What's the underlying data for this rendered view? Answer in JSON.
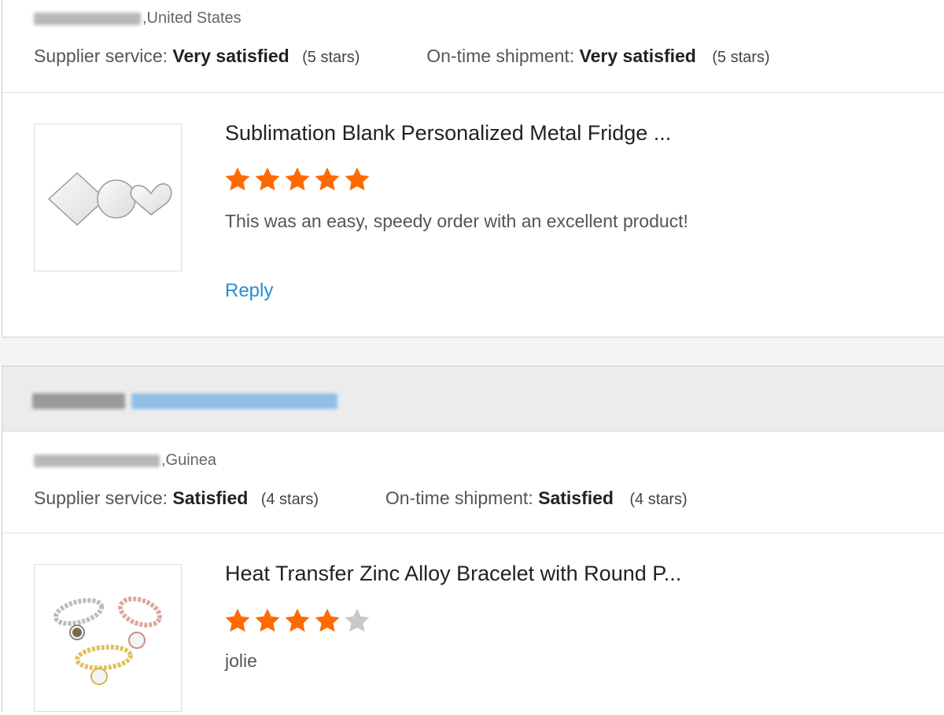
{
  "reviews": [
    {
      "buyer_country": ",United States",
      "supplier_service_label": "Supplier service:",
      "supplier_service_value": "Very satisfied",
      "supplier_service_stars": "(5 stars)",
      "shipment_label": "On-time shipment:",
      "shipment_value": "Very satisfied",
      "shipment_stars": "(5 stars)",
      "product_title": "Sublimation Blank Personalized Metal Fridge ...",
      "rating": 5,
      "comment": "This was an easy, speedy order with an excellent product!",
      "reply_label": "Reply"
    },
    {
      "buyer_country": ",Guinea",
      "supplier_service_label": "Supplier service:",
      "supplier_service_value": "Satisfied",
      "supplier_service_stars": "(4 stars)",
      "shipment_label": "On-time shipment:",
      "shipment_value": "Satisfied",
      "shipment_stars": "(4 stars)",
      "product_title": "Heat Transfer Zinc Alloy Bracelet with Round P...",
      "rating": 4,
      "comment": "jolie"
    }
  ],
  "colors": {
    "star_on": "#ff6a00",
    "star_off": "#c8c8cc",
    "link": "#2a8bd3"
  }
}
